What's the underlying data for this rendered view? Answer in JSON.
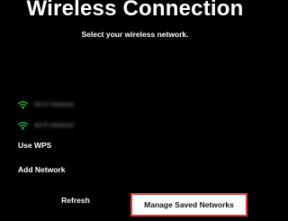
{
  "screen": {
    "title": "Wireless Connection",
    "subtitle": "Select your wireless network."
  },
  "networks": [
    {
      "name": "Wi-Fi Network",
      "icon": "wifi-icon",
      "icon_color": "#2fbf3a"
    },
    {
      "name": "Wi-Fi Network",
      "icon": "wifi-icon",
      "icon_color": "#2fbf3a"
    }
  ],
  "menu": {
    "use_wps": "Use WPS",
    "add_network": "Add Network"
  },
  "buttons": {
    "refresh": "Refresh",
    "manage_saved_networks": "Manage Saved Networks",
    "focus_border_color": "#e23a3a"
  }
}
